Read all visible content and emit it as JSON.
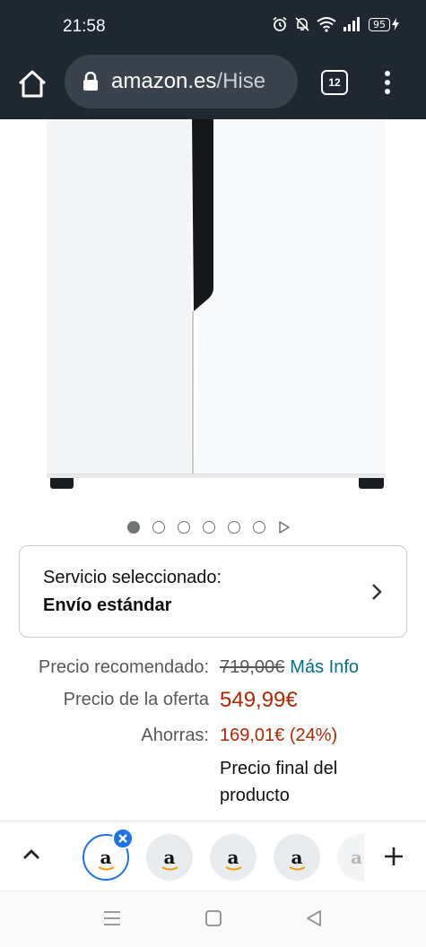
{
  "status_bar": {
    "time": "21:58",
    "battery": "95"
  },
  "browser": {
    "url_domain": "amazon.es",
    "url_path": "/Hise",
    "tab_count": "12"
  },
  "carousel": {
    "total_dots": 6,
    "active_index": 0
  },
  "service": {
    "label": "Servicio seleccionado:",
    "value": "Envío estándar"
  },
  "pricing": {
    "recommended_label": "Precio recomendado:",
    "recommended_value": "719,00€",
    "more_info": "Más Info",
    "offer_label": "Precio de la oferta",
    "offer_value": "549,99€",
    "savings_label": "Ahorras:",
    "savings_value": "169,01€ (24%)",
    "final_note": "Precio final del producto"
  },
  "tab_strip": {
    "thumb_letter": "a"
  },
  "colors": {
    "accent": "#1a73e8",
    "price_red": "#b12704",
    "link_teal": "#007185",
    "topbar": "#1f2731"
  },
  "icons": [
    "home-icon",
    "lock-icon",
    "tabs-icon",
    "menu-icon",
    "alarm-icon",
    "mute-icon",
    "wifi-icon",
    "signal-icon",
    "battery-icon",
    "chevron-right-icon",
    "chevron-up-icon",
    "close-icon",
    "plus-icon",
    "recents-icon",
    "home-square-icon",
    "back-icon"
  ]
}
